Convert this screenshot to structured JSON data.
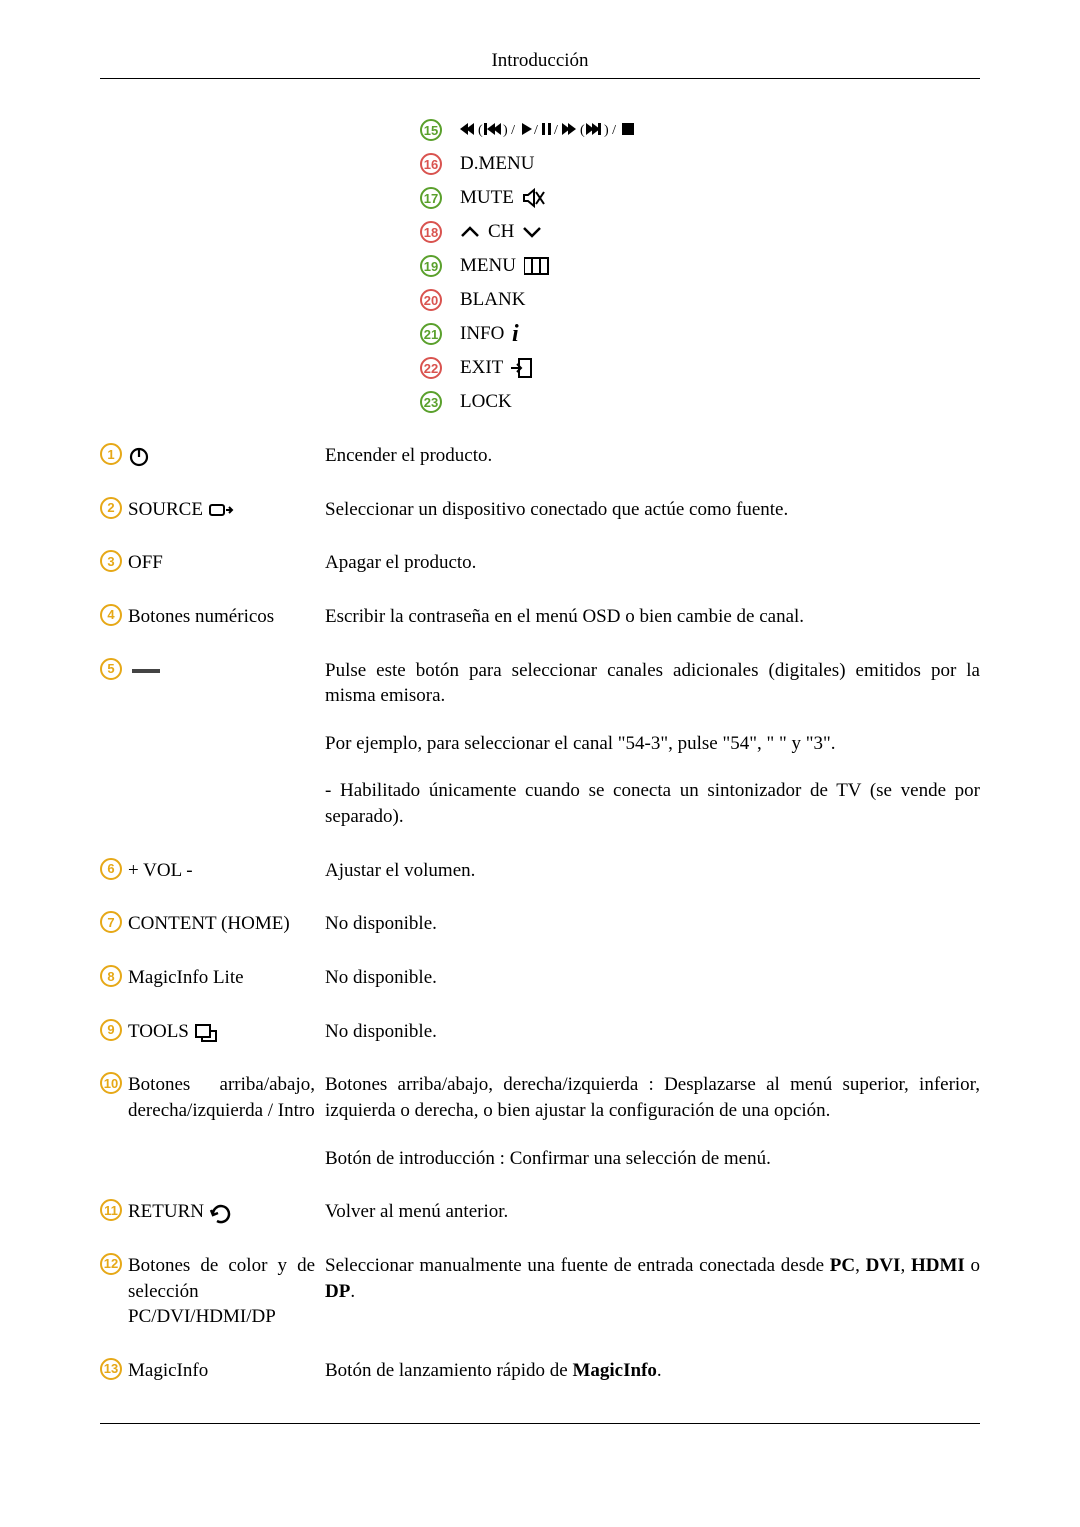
{
  "header_title": "Introducción",
  "top_items": [
    {
      "num": "15",
      "label": "",
      "icon": "playback"
    },
    {
      "num": "16",
      "label": "D.MENU",
      "icon": ""
    },
    {
      "num": "17",
      "label": "MUTE",
      "icon": "mute"
    },
    {
      "num": "18",
      "label": "CH",
      "icon": "ch"
    },
    {
      "num": "19",
      "label": "MENU",
      "icon": "menu"
    },
    {
      "num": "20",
      "label": "BLANK",
      "icon": ""
    },
    {
      "num": "21",
      "label": "INFO",
      "icon": "info"
    },
    {
      "num": "22",
      "label": "EXIT",
      "icon": "exit"
    },
    {
      "num": "23",
      "label": "LOCK",
      "icon": ""
    }
  ],
  "main_rows": [
    {
      "num": "1",
      "badge": "orange",
      "label": "",
      "icon": "power",
      "desc": [
        "Encender el producto."
      ]
    },
    {
      "num": "2",
      "badge": "orange",
      "label": "SOURCE",
      "icon": "source",
      "desc": [
        "Seleccionar un dispositivo conectado que actúe como fuente."
      ]
    },
    {
      "num": "3",
      "badge": "orange",
      "label": "OFF",
      "icon": "",
      "desc": [
        "Apagar el producto."
      ]
    },
    {
      "num": "4",
      "badge": "orange",
      "label": "Botones numéricos",
      "icon": "",
      "desc": [
        "Escribir la contraseña en el menú OSD o bien cambie de canal."
      ]
    },
    {
      "num": "5",
      "badge": "orange",
      "label": "",
      "icon": "dash",
      "desc": [
        "Pulse este botón para seleccionar canales adicionales (digitales) emitidos por la misma emisora.",
        "Por ejemplo, para seleccionar el canal \"54-3\", pulse \"54\", \" \" y \"3\".",
        "- Habilitado únicamente cuando se conecta un sintonizador de TV (se vende por separado)."
      ]
    },
    {
      "num": "6",
      "badge": "orange",
      "label": "+ VOL -",
      "icon": "",
      "desc": [
        "Ajustar el volumen."
      ]
    },
    {
      "num": "7",
      "badge": "orange",
      "label": "CONTENT (HOME)",
      "icon": "",
      "desc": [
        "No disponible."
      ]
    },
    {
      "num": "8",
      "badge": "orange",
      "label": "MagicInfo Lite",
      "icon": "",
      "desc": [
        "No disponible."
      ]
    },
    {
      "num": "9",
      "badge": "orange",
      "label": "TOOLS",
      "icon": "tools",
      "desc": [
        "No disponible."
      ]
    },
    {
      "num": "10",
      "badge": "orange",
      "label": "Botones arriba/abajo, derecha/izquierda / Intro",
      "icon": "",
      "desc": [
        "Botones arriba/abajo, derecha/izquierda : Desplazarse al menú superior, inferior, izquierda o derecha, o bien ajustar la configuración de una opción.",
        "Botón de introducción : Confirmar una selección de menú."
      ]
    },
    {
      "num": "11",
      "badge": "orange",
      "label": "RETURN",
      "icon": "return",
      "desc": [
        "Volver al menú anterior."
      ]
    },
    {
      "num": "12",
      "badge": "orange",
      "label": "Botones de color y de selección PC/DVI/HDMI/DP",
      "icon": "",
      "desc_html": "Seleccionar manualmente una fuente de entrada conectada desde <b>PC</b>, <b>DVI</b>, <b>HDMI</b> o <b>DP</b>."
    },
    {
      "num": "13",
      "badge": "orange",
      "label": "MagicInfo",
      "icon": "",
      "desc_html": "Botón de lanzamiento rápido de <b>MagicInfo</b>."
    }
  ]
}
